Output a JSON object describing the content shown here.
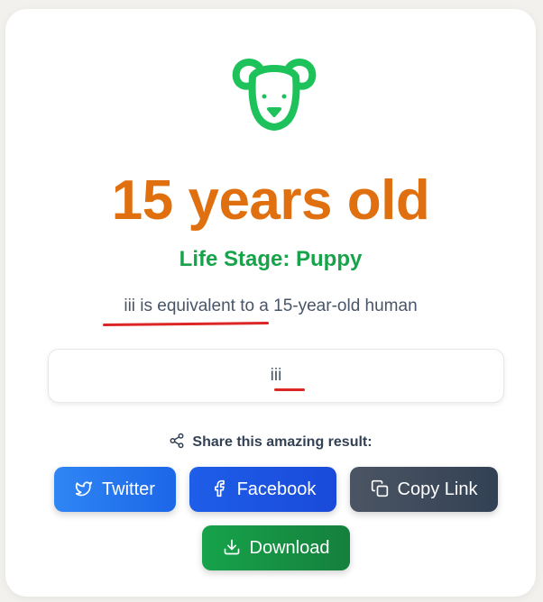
{
  "result": {
    "age_title": "15 years old",
    "life_stage": "Life Stage: Puppy",
    "equivalence_text": "iii is equivalent to a 15-year-old human",
    "pet_name": "iii"
  },
  "share": {
    "label": "Share this amazing result:",
    "buttons": {
      "twitter": "Twitter",
      "facebook": "Facebook",
      "copy_link": "Copy Link",
      "download": "Download"
    }
  },
  "icons": {
    "header": "dog-face-icon",
    "share": "share-icon",
    "twitter": "twitter-icon",
    "facebook": "facebook-icon",
    "copy": "copy-icon",
    "download": "download-icon"
  },
  "colors": {
    "age_title": "#e0700f",
    "life_stage": "#16a34a",
    "dog_icon": "#1ec25a",
    "annotation_red": "#dc2626",
    "twitter": "#2f86f4",
    "facebook": "#1e5ee8",
    "copy_link": "#4b5563",
    "download": "#16a34a"
  }
}
